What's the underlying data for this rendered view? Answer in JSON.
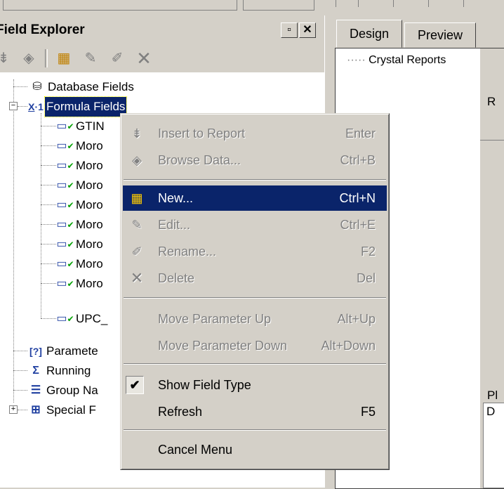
{
  "explorer": {
    "title": "Field Explorer",
    "tree": {
      "database": "Database Fields",
      "formula": "Formula Fields",
      "children": [
        "GTIN",
        "Moro",
        "Moro",
        "Moro",
        "Moro",
        "Moro",
        "Moro",
        "Moro",
        "Moro",
        "UPC_"
      ],
      "parameter": "Paramete",
      "running": "Running",
      "group": "Group Na",
      "special": "Special F"
    }
  },
  "tabs": {
    "design": "Design",
    "preview": "Preview"
  },
  "design": {
    "section_label": "Crystal Reports",
    "right_letters": [
      "R",
      "Pl",
      "D"
    ]
  },
  "menu": {
    "insert": {
      "label": "Insert to Report",
      "key": "Enter"
    },
    "browse": {
      "label": "Browse Data...",
      "key": "Ctrl+B"
    },
    "new": {
      "label": "New...",
      "key": "Ctrl+N"
    },
    "edit": {
      "label": "Edit...",
      "key": "Ctrl+E"
    },
    "rename": {
      "label": "Rename...",
      "key": "F2"
    },
    "delete": {
      "label": "Delete",
      "key": "Del"
    },
    "move_up": {
      "label": "Move Parameter Up",
      "key": "Alt+Up"
    },
    "move_down": {
      "label": "Move Parameter Down",
      "key": "Alt+Down"
    },
    "show_field_type": {
      "label": "Show Field Type",
      "checked": true
    },
    "refresh": {
      "label": "Refresh",
      "key": "F5"
    },
    "cancel": {
      "label": "Cancel Menu"
    }
  },
  "colors": {
    "selection": "#0a246a",
    "face": "#d4d0c8",
    "formula_icon": "#1f3fa0",
    "check_green": "#00a000"
  }
}
